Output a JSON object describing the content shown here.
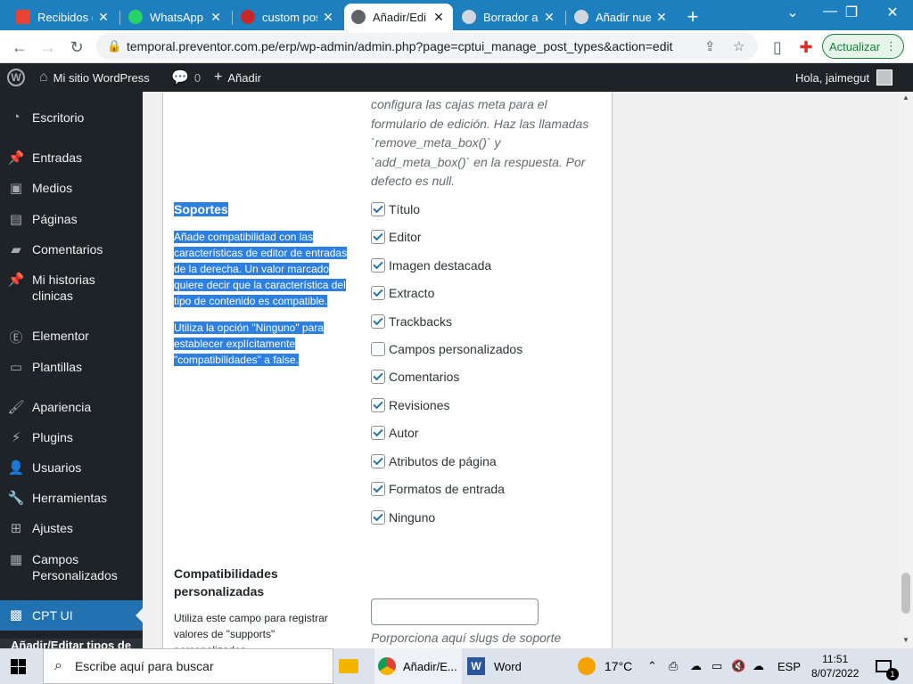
{
  "browser": {
    "tabs": [
      {
        "label": "Recibidos (",
        "favicon_color": "#ea4335",
        "active": false
      },
      {
        "label": "WhatsApp",
        "favicon_color": "#25d366",
        "active": false
      },
      {
        "label": "custom pos",
        "favicon_color": "#c62828",
        "active": false
      },
      {
        "label": "Añadir/Edi",
        "favicon_color": "#5f6368",
        "active": true
      },
      {
        "label": "Borrador a",
        "favicon_color": "#d0d7de",
        "active": false
      },
      {
        "label": "Añadir nue",
        "favicon_color": "#d0d7de",
        "active": false
      }
    ],
    "url": "temporal.preventor.com.pe/erp/wp-admin/admin.php?page=cptui_manage_post_types&action=edit",
    "update_button": "Actualizar"
  },
  "wpbar": {
    "site_name": "Mi sitio WordPress",
    "comments_count": "0",
    "add_new": "Añadir",
    "greeting": "Hola, jaimegut"
  },
  "sidebar": {
    "items": [
      {
        "label": "Escritorio",
        "icon": "dashboard-icon"
      },
      {
        "label": "Entradas",
        "icon": "pin-icon"
      },
      {
        "label": "Medios",
        "icon": "media-icon"
      },
      {
        "label": "Páginas",
        "icon": "pages-icon"
      },
      {
        "label": "Comentarios",
        "icon": "comments-icon"
      },
      {
        "label": "Mi historias clinicas",
        "icon": "pin-icon"
      },
      {
        "label": "Elementor",
        "icon": "elementor-icon"
      },
      {
        "label": "Plantillas",
        "icon": "folder-icon"
      },
      {
        "label": "Apariencia",
        "icon": "brush-icon"
      },
      {
        "label": "Plugins",
        "icon": "plugin-icon"
      },
      {
        "label": "Usuarios",
        "icon": "user-icon"
      },
      {
        "label": "Herramientas",
        "icon": "wrench-icon"
      },
      {
        "label": "Ajustes",
        "icon": "settings-icon"
      },
      {
        "label": "Campos Personalizados",
        "icon": "table-icon"
      },
      {
        "label": "CPT UI",
        "icon": "cptui-icon"
      }
    ],
    "submenu_partial": "Añadir/Editar tipos de"
  },
  "content": {
    "prev_desc": "configura las cajas meta para el formulario de edición. Haz las llamadas `remove_meta_box()` y `add_meta_box()` en la respuesta. Por defecto es null.",
    "supports_title": "Soportes",
    "supports_help_1": "Añade compatibilidad con las características de editor de entradas de la derecha. Un valor marcado quiere decir que la característica del tipo de contenido es compatible.",
    "supports_help_2": "Utiliza la opción \"Ninguno\" para establecer explícitamente \"compatibilidades\" a false.",
    "checkboxes": [
      {
        "label": "Título",
        "checked": true
      },
      {
        "label": "Editor",
        "checked": true
      },
      {
        "label": "Imagen destacada",
        "checked": true
      },
      {
        "label": "Extracto",
        "checked": true
      },
      {
        "label": "Trackbacks",
        "checked": true
      },
      {
        "label": "Campos personalizados",
        "checked": false
      },
      {
        "label": "Comentarios",
        "checked": true
      },
      {
        "label": "Revisiones",
        "checked": true
      },
      {
        "label": "Autor",
        "checked": true
      },
      {
        "label": "Atributos de página",
        "checked": true
      },
      {
        "label": "Formatos de entrada",
        "checked": true
      },
      {
        "label": "Ninguno",
        "checked": true
      }
    ],
    "custom_supports_title": "Compatibilidades personalizadas",
    "custom_supports_help": "Utiliza este campo para registrar valores de \"supports\" personalizados,",
    "custom_supports_value": "",
    "custom_supports_desc": "Porporciona aquí slugs de soporte"
  },
  "taskbar": {
    "search_placeholder": "Escribe aquí para buscar",
    "chrome_label": "Añadir/E...",
    "word_label": "Word",
    "temperature": "17°C",
    "language": "ESP",
    "time": "11:51",
    "date": "8/07/2022",
    "notifications": "1"
  }
}
